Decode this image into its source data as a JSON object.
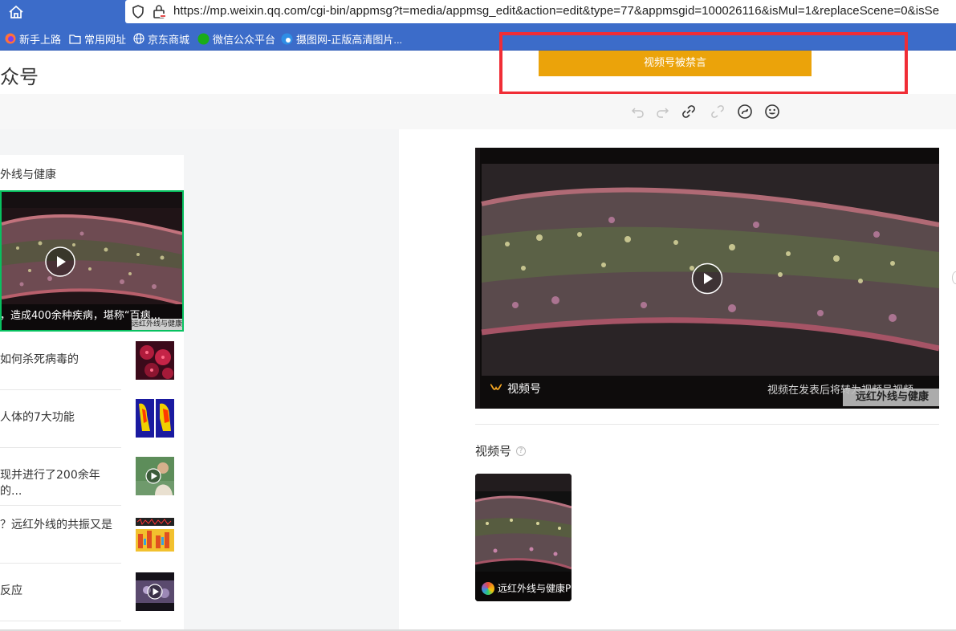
{
  "browser": {
    "url": "https://mp.weixin.qq.com/cgi-bin/appmsg?t=media/appmsg_edit&action=edit&type=77&appmsgid=100026116&isMul=1&replaceScene=0&isSe",
    "bookmarks": [
      "新手上路",
      "常用网址",
      "京东商城",
      "微信公众平台",
      "摄图网-正版高清图片..."
    ]
  },
  "header": {
    "title": "众号",
    "ban_text": "视频号被禁言"
  },
  "left_panel": {
    "account_name": "外线与健康",
    "cover_caption": "，造成400余种疾病，堪称“百病...",
    "cover_watermark": "远红外线与健康",
    "items": [
      {
        "title": "如何杀死病毒的",
        "thumb": "red-cells"
      },
      {
        "title": "人体的7大功能",
        "thumb": "thermal"
      },
      {
        "title": "现并进行了200余年的...",
        "thumb": "person-video"
      },
      {
        "title": "？远红外线的共振又是",
        "thumb": "spectrum"
      },
      {
        "title": "反应",
        "thumb": "dark-video"
      }
    ]
  },
  "editor": {
    "video_label": "视频号",
    "video_note": "视频在发表后将转为视频号视频",
    "video_watermark": "远红外线与健康",
    "section_label": "视频号",
    "help_glyph": "?",
    "channel_name": "远红外线与健康P"
  },
  "colors": {
    "chrome": "#3c6cc9",
    "ban_banner": "#eba30a",
    "ban_outline": "#f02d36",
    "selected_border": "#07c160"
  }
}
